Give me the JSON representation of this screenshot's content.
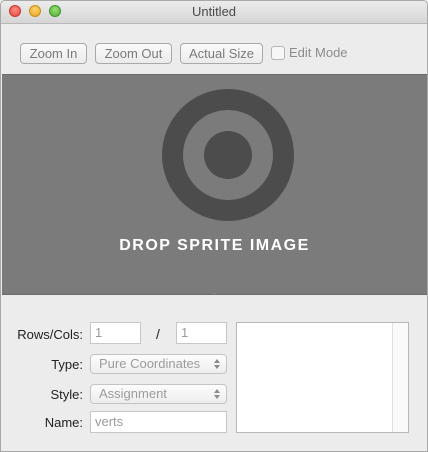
{
  "window": {
    "title": "Untitled"
  },
  "toolbar": {
    "zoom_in_label": "Zoom In",
    "zoom_out_label": "Zoom Out",
    "actual_size_label": "Actual Size",
    "edit_mode_label": "Edit Mode",
    "edit_mode_checked": false
  },
  "canvas": {
    "drop_text": "DROP SPRITE IMAGE",
    "icon": "target-icon"
  },
  "form": {
    "rows_cols_label": "Rows/Cols:",
    "rows_value": "1",
    "separator": "/",
    "cols_value": "1",
    "type_label": "Type:",
    "type_value": "Pure Coordinates",
    "style_label": "Style:",
    "style_value": "Assignment",
    "name_label": "Name:",
    "name_value": "verts"
  },
  "colors": {
    "canvas_bg": "#7b7b7b",
    "window_bg": "#ececec",
    "target_ring": "#4a4a4a"
  }
}
